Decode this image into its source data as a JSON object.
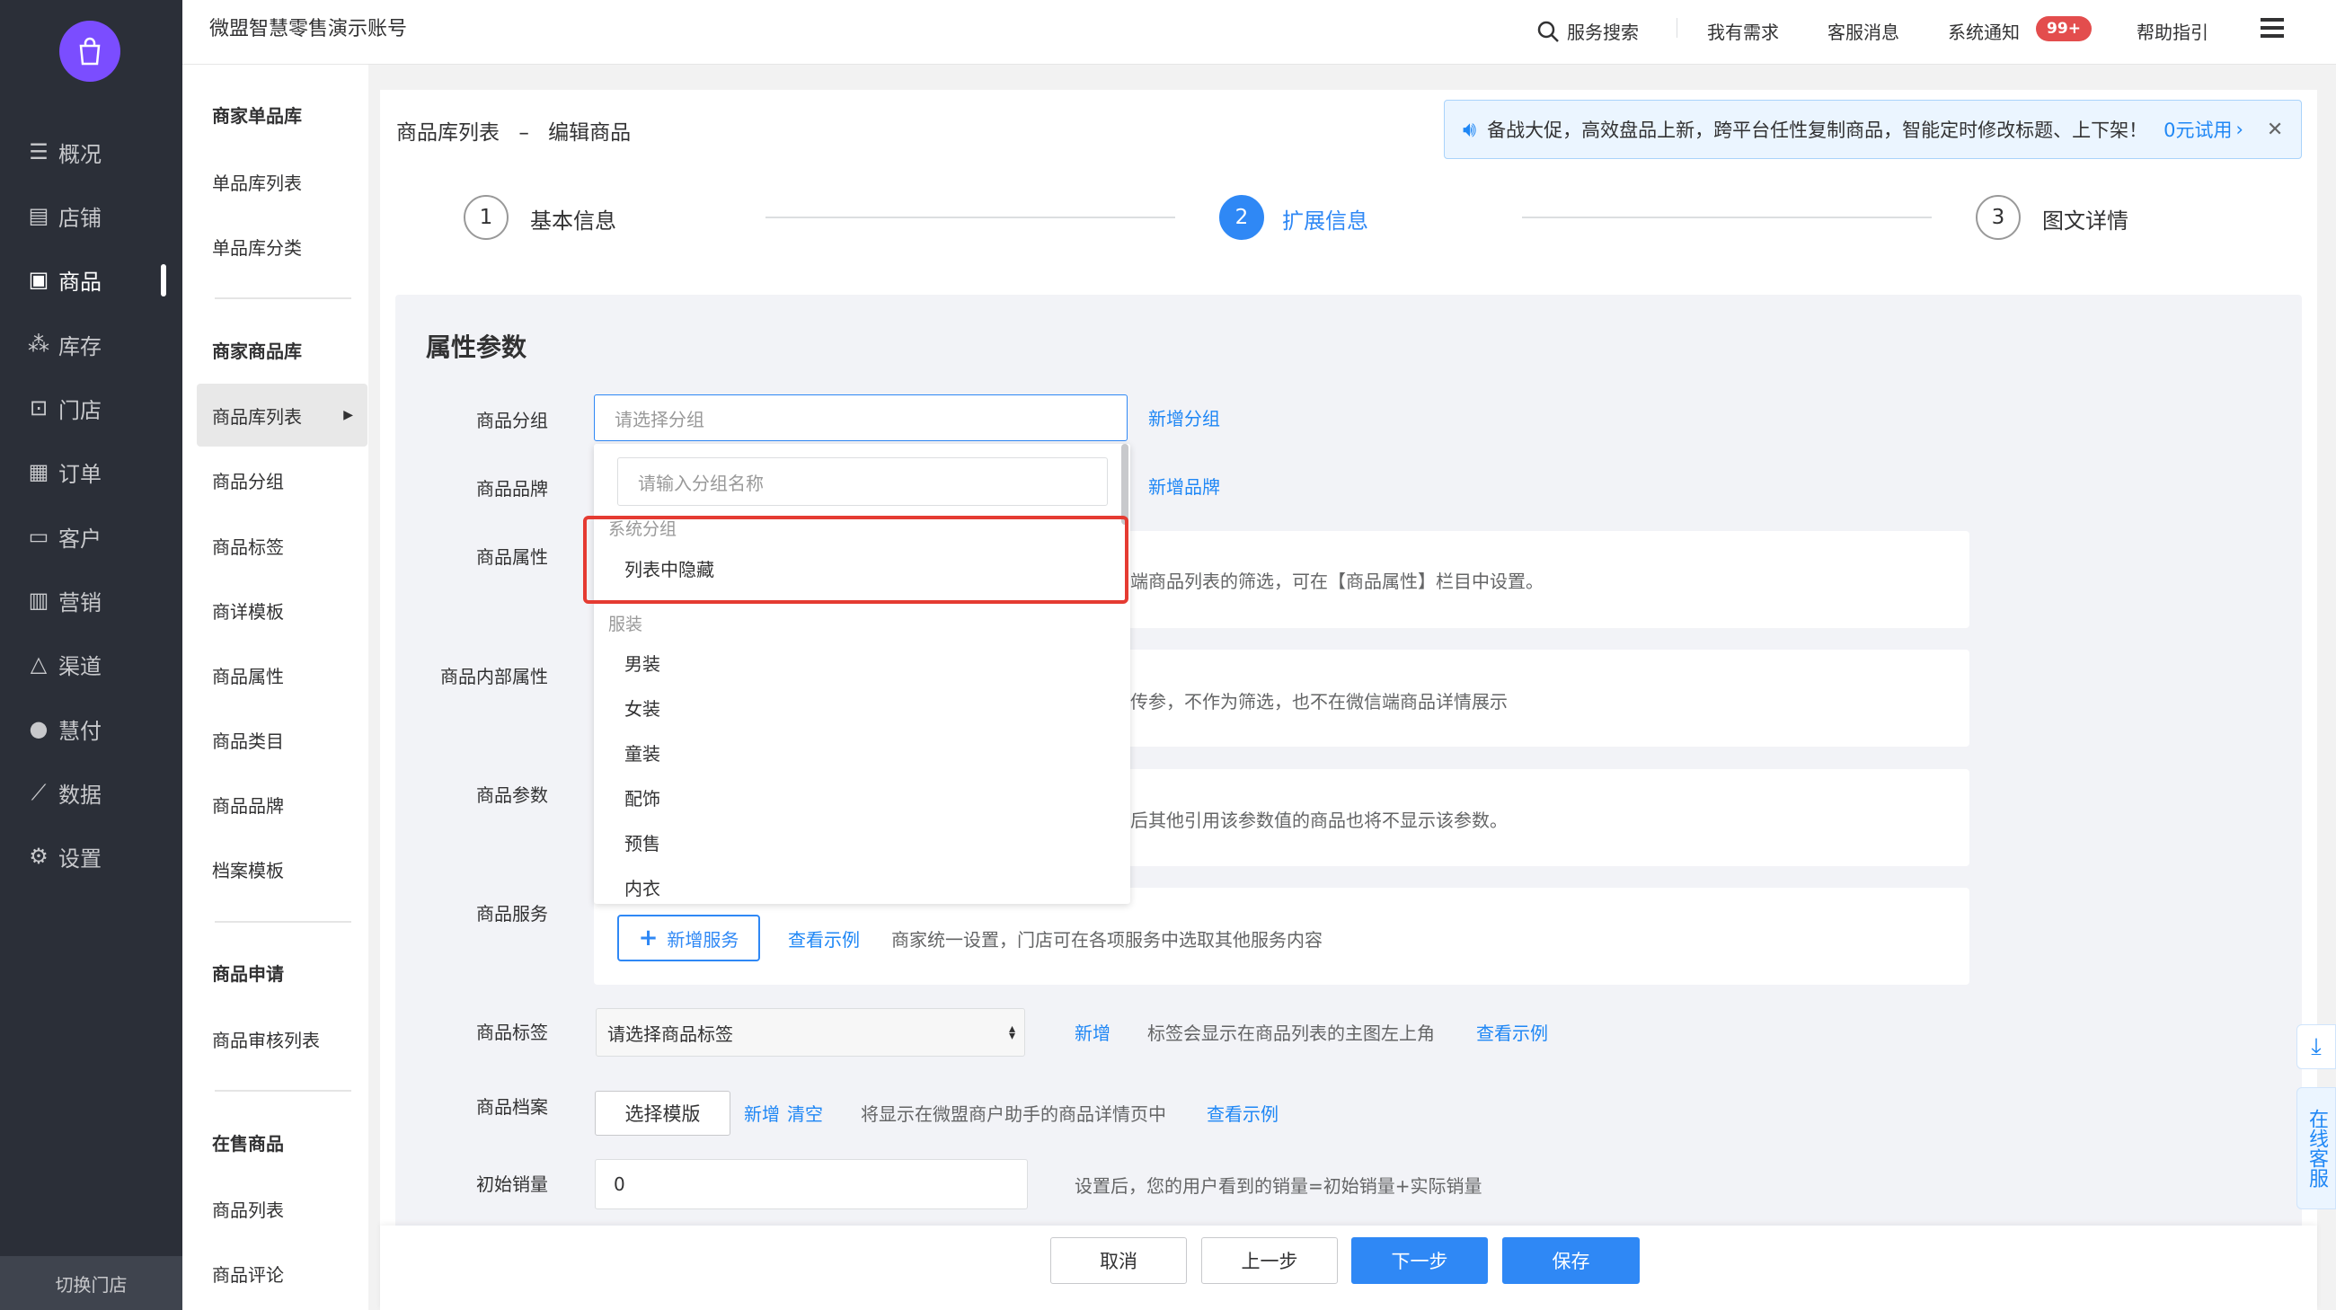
{
  "sidebar": {
    "items": [
      {
        "label": "概况",
        "icon": "list-icon"
      },
      {
        "label": "店铺",
        "icon": "shop-icon"
      },
      {
        "label": "商品",
        "icon": "goods-icon"
      },
      {
        "label": "库存",
        "icon": "stock-icon"
      },
      {
        "label": "门店",
        "icon": "store-icon"
      },
      {
        "label": "订单",
        "icon": "order-icon"
      },
      {
        "label": "客户",
        "icon": "vip-icon"
      },
      {
        "label": "营销",
        "icon": "chart-icon"
      },
      {
        "label": "渠道",
        "icon": "channel-icon"
      },
      {
        "label": "慧付",
        "icon": "pay-icon"
      },
      {
        "label": "数据",
        "icon": "data-icon"
      },
      {
        "label": "设置",
        "icon": "gear-icon"
      }
    ],
    "active_index": 2,
    "switch_label": "切换门店"
  },
  "subnav": {
    "items": [
      "商家单品库",
      "单品库列表",
      "单品库分类",
      "商家商品库",
      "商品库列表",
      "商品分组",
      "商品标签",
      "商详模板",
      "商品属性",
      "商品类目",
      "商品品牌",
      "档案模板",
      "商品申请",
      "商品审核列表",
      "在售商品",
      "商品列表",
      "商品评论"
    ]
  },
  "topbar": {
    "account": "微盟智慧零售演示账号",
    "search": "服务搜索",
    "demand": "我有需求",
    "service_msg": "客服消息",
    "notify": "系统通知",
    "badge": "99+",
    "help": "帮助指引"
  },
  "breadcrumb": {
    "parent": "商品库列表",
    "sep": "–",
    "current": "编辑商品"
  },
  "notice": {
    "text": "备战大促，高效盘品上新，跨平台任性复制商品，智能定时修改标题、上下架！",
    "link": "0元试用"
  },
  "steps": [
    {
      "num": "1",
      "label": "基本信息"
    },
    {
      "num": "2",
      "label": "扩展信息"
    },
    {
      "num": "3",
      "label": "图文详情"
    }
  ],
  "section": {
    "title": "属性参数"
  },
  "form": {
    "group_label": "商品分组",
    "group_placeholder": "请选择分组",
    "group_add": "新增分组",
    "brand_label": "商品品牌",
    "brand_add": "新增品牌",
    "attr_label": "商品属性",
    "attr_hint": "端商品列表的筛选，可在【商品属性】栏目中设置。",
    "inner_attr_label": "商品内部属性",
    "inner_attr_hint": "传参，不作为筛选，也不在微信端商品详情展示",
    "param_label": "商品参数",
    "param_hint": "后其他引用该参数值的商品也将不显示该参数。",
    "service_label": "商品服务",
    "service_add": "新增服务",
    "service_example": "查看示例",
    "service_hint": "商家统一设置，门店可在各项服务中选取其他服务内容",
    "tag_label": "商品标签",
    "tag_select": "请选择商品标签",
    "tag_add": "新增",
    "tag_hint": "标签会显示在商品列表的主图左上角",
    "tag_example": "查看示例",
    "archive_label": "商品档案",
    "archive_btn": "选择模版",
    "archive_add": "新增",
    "archive_clear": "清空",
    "archive_hint": "将显示在微盟商户助手的商品详情页中",
    "archive_example": "查看示例",
    "sales_label": "初始销量",
    "sales_value": "0",
    "sales_hint": "设置后，您的用户看到的销量=初始销量+实际销量"
  },
  "dropdown": {
    "search_placeholder": "请输入分组名称",
    "groups": [
      {
        "title": "系统分组",
        "items": [
          "列表中隐藏"
        ]
      },
      {
        "title": "服装",
        "items": [
          "男装",
          "女装",
          "童装",
          "配饰",
          "预售",
          "内衣"
        ]
      }
    ]
  },
  "footer": {
    "cancel": "取消",
    "prev": "上一步",
    "next": "下一步",
    "save": "保存"
  },
  "float": {
    "online_service": "在线客服"
  },
  "colors": {
    "primary": "#2f88f5",
    "sidebar": "#2b2f38",
    "highlight": "#e53b32",
    "badge": "#e34d4d"
  }
}
